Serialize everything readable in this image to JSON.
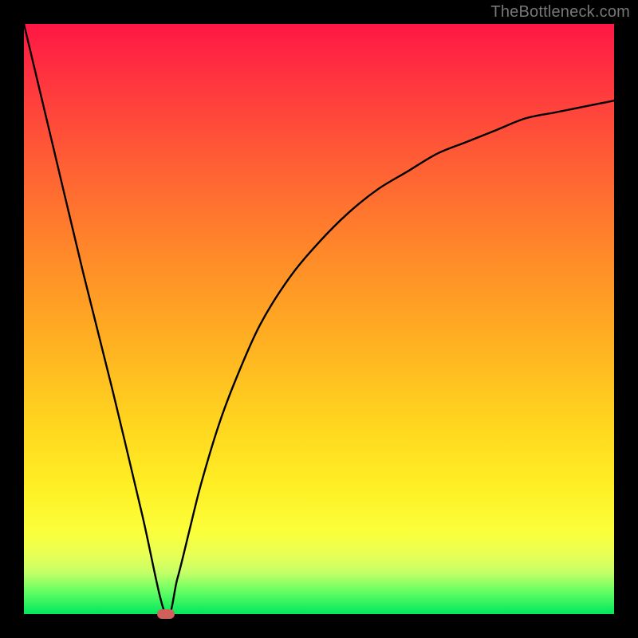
{
  "watermark": "TheBottleneck.com",
  "chart_data": {
    "type": "line",
    "title": "",
    "xlabel": "",
    "ylabel": "",
    "xlim": [
      0,
      100
    ],
    "ylim": [
      0,
      100
    ],
    "grid": false,
    "legend": false,
    "series": [
      {
        "name": "curve",
        "x": [
          0,
          5,
          10,
          15,
          20,
          24,
          26,
          28,
          30,
          33,
          36,
          40,
          45,
          50,
          55,
          60,
          65,
          70,
          75,
          80,
          85,
          90,
          95,
          100
        ],
        "y": [
          100,
          79,
          58,
          38,
          17,
          0,
          6,
          14,
          22,
          32,
          40,
          49,
          57,
          63,
          68,
          72,
          75,
          78,
          80,
          82,
          84,
          85,
          86,
          87
        ]
      }
    ],
    "marker": {
      "x": 24,
      "y": 0
    },
    "background_gradient": {
      "top": "#ff1744",
      "mid": "#ffd61f",
      "bottom": "#00e85e"
    }
  }
}
